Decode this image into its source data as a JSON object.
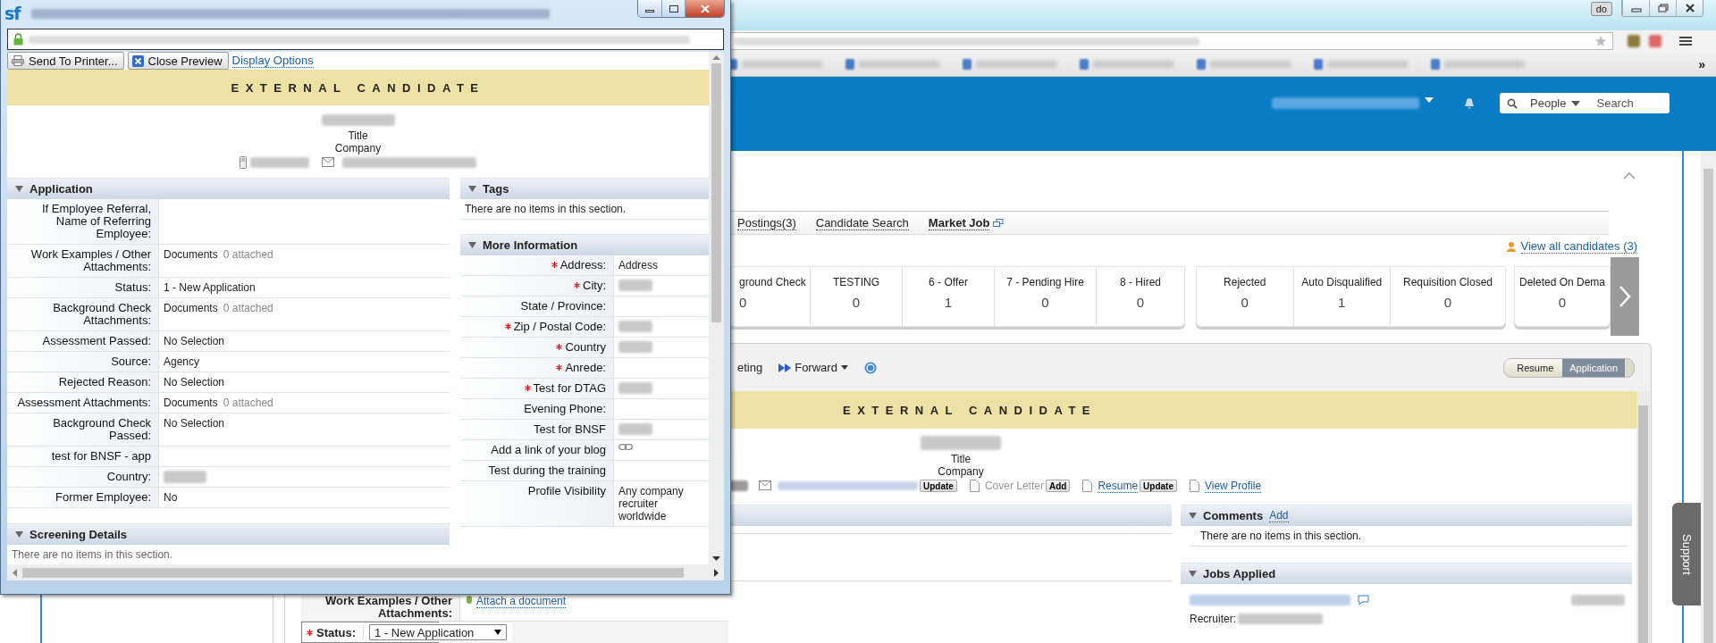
{
  "browser": {
    "profile_badge": "do",
    "overflow": "»"
  },
  "popup": {
    "logo": "sf",
    "toolbar": [
      {
        "kind": "print",
        "label": "Send To Printer..."
      },
      {
        "kind": "close",
        "label": "Close Preview"
      },
      {
        "kind": "link",
        "label": "Display Options"
      }
    ],
    "banner": "EXTERNAL CANDIDATE",
    "title": "Title",
    "company": "Company",
    "application": {
      "title": "Application",
      "rows": [
        {
          "label": "If Employee Referral, Name of Referring Employee:",
          "kind": "empty"
        },
        {
          "label": "Work Examples / Other Attachments:",
          "kind": "documents",
          "value": "Documents",
          "note": "0 attached"
        },
        {
          "label": "Status:",
          "kind": "text",
          "value": "1 - New Application"
        },
        {
          "label": "Background Check Attachments:",
          "kind": "documents",
          "value": "Documents",
          "note": "0 attached"
        },
        {
          "label": "Assessment Passed:",
          "kind": "text",
          "value": "No Selection"
        },
        {
          "label": "Source:",
          "kind": "text",
          "value": "Agency"
        },
        {
          "label": "Rejected Reason:",
          "kind": "text",
          "value": "No Selection"
        },
        {
          "label": "Assessment Attachments:",
          "kind": "documents",
          "value": "Documents",
          "note": "0 attached"
        },
        {
          "label": "Background Check Passed:",
          "kind": "text",
          "value": "No Selection"
        },
        {
          "label": "test for BNSF - app",
          "kind": "empty"
        },
        {
          "label": "Country:",
          "kind": "blurred"
        },
        {
          "label": "Former Employee:",
          "kind": "text",
          "value": "No"
        }
      ]
    },
    "screening": {
      "title": "Screening Details",
      "empty": "There are no items in this section."
    },
    "tags": {
      "title": "Tags",
      "empty": "There are no items in this section."
    },
    "more_info": {
      "title": "More Information",
      "rows": [
        {
          "label": "Address:",
          "required": true,
          "kind": "text",
          "value": "Address"
        },
        {
          "label": "City:",
          "required": true,
          "kind": "blurred"
        },
        {
          "label": "State / Province:",
          "required": false,
          "kind": "empty"
        },
        {
          "label": "Zip / Postal Code:",
          "required": true,
          "kind": "blurred"
        },
        {
          "label": "Country",
          "required": true,
          "kind": "blurred"
        },
        {
          "label": "Anrede:",
          "required": true,
          "kind": "empty"
        },
        {
          "label": "Test for DTAG",
          "required": true,
          "kind": "blurred"
        },
        {
          "label": "Evening Phone:",
          "required": false,
          "kind": "empty"
        },
        {
          "label": "Test for BNSF",
          "required": false,
          "kind": "blurred"
        },
        {
          "label": "Add a link of your blog",
          "required": false,
          "kind": "link"
        },
        {
          "label": "Test during the training",
          "required": false,
          "kind": "empty"
        },
        {
          "label": "Profile Visibility",
          "required": false,
          "kind": "text",
          "value": "Any company recruiter worldwide"
        }
      ]
    }
  },
  "header": {
    "search_scope": "People",
    "search_placeholder": "Search"
  },
  "tabs": [
    {
      "label": "Postings(3)",
      "selected": false
    },
    {
      "label": "Candidate Search",
      "selected": false
    },
    {
      "label": "Market Job",
      "selected": true
    }
  ],
  "view_all": "View all candidates (3)",
  "pipeline": [
    {
      "stages": [
        {
          "label": "ground Check",
          "count": "0"
        },
        {
          "label": "TESTING",
          "count": "0"
        },
        {
          "label": "6 - Offer",
          "count": "1"
        },
        {
          "label": "7 - Pending Hire",
          "count": "0"
        },
        {
          "label": "8 - Hired",
          "count": "0"
        }
      ]
    },
    {
      "stages": [
        {
          "label": "Rejected",
          "count": "0"
        },
        {
          "label": "Auto Disqualified",
          "count": "1"
        },
        {
          "label": "Requisition Closed",
          "count": "0"
        }
      ]
    },
    {
      "stages": [
        {
          "label": "Deleted On Dema",
          "count": "0"
        }
      ]
    }
  ],
  "actions": [
    {
      "kind": "text",
      "label": "eting"
    },
    {
      "kind": "forward",
      "label": "Forward"
    },
    {
      "kind": "help"
    }
  ],
  "view_toggle": [
    {
      "label": "Resume",
      "selected": false
    },
    {
      "label": "Application",
      "selected": true
    }
  ],
  "detail": {
    "banner": "EXTERNAL CANDIDATE",
    "title": "Title",
    "company": "Company",
    "email_button": "Update",
    "docs": [
      {
        "label": "Cover Letter",
        "enabled": false,
        "button": "Add"
      },
      {
        "label": "Resume",
        "enabled": true,
        "button": "Update"
      },
      {
        "label": "View Profile",
        "enabled": true
      }
    ],
    "comments": {
      "title": "Comments",
      "action": "Add",
      "empty": "There are no items in this section."
    },
    "jobs": {
      "title": "Jobs Applied",
      "recruiter": "Recruiter:"
    }
  },
  "form": [
    {
      "label": "Work Examples / Other Attachments:",
      "required": false,
      "kind": "attach",
      "value": "Attach a document"
    },
    {
      "label": "Status:",
      "required": true,
      "kind": "select",
      "value": "1 - New Application"
    }
  ],
  "support": "Support"
}
